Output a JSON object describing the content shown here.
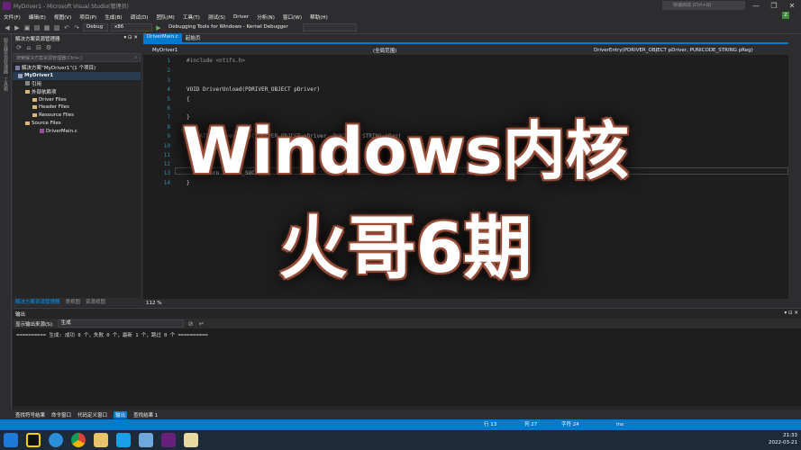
{
  "window": {
    "title": "MyDriver1 - Microsoft Visual Studio(管理员)",
    "quick_launch": "快速启动 (Ctrl+Q)",
    "win_buttons": [
      "—",
      "❐",
      "✕"
    ]
  },
  "menu": {
    "items": [
      "文件(F)",
      "编辑(E)",
      "视图(V)",
      "项目(P)",
      "生成(B)",
      "调试(D)",
      "团队(M)",
      "工具(T)",
      "测试(S)",
      "Driver",
      "分析(N)",
      "窗口(W)",
      "帮助(H)"
    ],
    "avatar": "Z"
  },
  "toolbar": {
    "config": "Debug",
    "platform": "x86",
    "debugger": "Debugging Tools for Windows - Kernel Debugger"
  },
  "vertical_strip": [
    "服务器资源管理器",
    "工具箱"
  ],
  "solution_explorer": {
    "title": "解决方案资源管理器",
    "search_placeholder": "搜索解决方案资源管理器(Ctrl+;)",
    "tree": [
      "解决方案“MyDriver1”(1 个项目)",
      "MyDriver1",
      "引用",
      "外部依赖项",
      "Driver Files",
      "Header Files",
      "Resource Files",
      "Source Files",
      "DriverMain.c"
    ],
    "tabs": [
      "解决方案资源管理器",
      "类视图",
      "资源视图"
    ]
  },
  "editor": {
    "tabs": [
      "DriverMain.c",
      "起始页"
    ],
    "nav": {
      "project": "MyDriver1",
      "scope": "(全局范围)",
      "member": "DriverEntry(PDRIVER_OBJECT pDriver, PUNICODE_STRING pReg)"
    },
    "lines": [
      {
        "n": "1",
        "t": "#include <ntifs.h>"
      },
      {
        "n": "2",
        "t": ""
      },
      {
        "n": "3",
        "t": ""
      },
      {
        "n": "4",
        "t": "VOID DriverUnload(PDRIVER_OBJECT pDriver)"
      },
      {
        "n": "5",
        "t": "{"
      },
      {
        "n": "6",
        "t": ""
      },
      {
        "n": "7",
        "t": "}"
      },
      {
        "n": "8",
        "t": ""
      },
      {
        "n": "9",
        "t": "NTSTATUS DriverEntry(PDRIVER_OBJECT pDriver, PUNICODE_STRING pReg)"
      },
      {
        "n": "10",
        "t": "{"
      },
      {
        "n": "11",
        "t": ""
      },
      {
        "n": "12",
        "t": ""
      },
      {
        "n": "13",
        "t": "    return STATUS_SUCCESS;"
      },
      {
        "n": "14",
        "t": "}"
      }
    ],
    "zoom": "112 %"
  },
  "output": {
    "title": "输出",
    "source_label": "显示输出来源(S):",
    "source_value": "生成",
    "text": "========== 生成: 成功 0 个，失败 0 个，最新 1 个，跳过 0 个 =========="
  },
  "bottom_tabs": [
    "查找符号结果",
    "命令窗口",
    "代码定义窗口",
    "输出",
    "查找结果 1"
  ],
  "status": {
    "line": "行 13",
    "col": "列 27",
    "ch": "字符 24",
    "ins": "Ins"
  },
  "tray": {
    "time": "21:33",
    "date": "2022-03-21"
  },
  "overlay": {
    "line1": "Windows内核",
    "line2": "火哥6期"
  },
  "colors": {
    "accent": "#007acc",
    "bg": "#2d2d30",
    "editor_bg": "#1e1e1e",
    "overlay_outline": "#a0523d"
  }
}
